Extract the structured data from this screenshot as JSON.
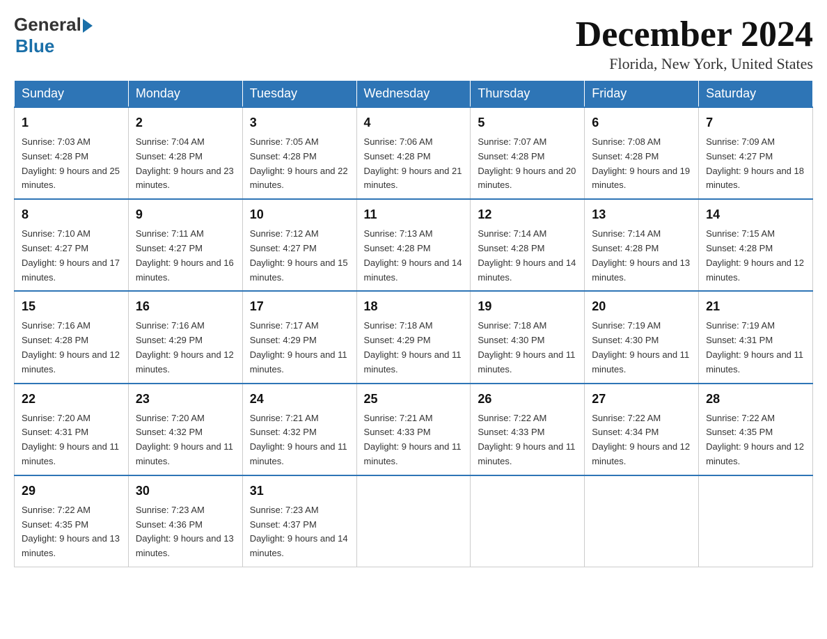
{
  "header": {
    "logo_general": "General",
    "logo_blue": "Blue",
    "logo_underline": "",
    "month_title": "December 2024",
    "location": "Florida, New York, United States"
  },
  "weekdays": [
    "Sunday",
    "Monday",
    "Tuesday",
    "Wednesday",
    "Thursday",
    "Friday",
    "Saturday"
  ],
  "weeks": [
    [
      {
        "day": "1",
        "sunrise": "7:03 AM",
        "sunset": "4:28 PM",
        "daylight": "9 hours and 25 minutes."
      },
      {
        "day": "2",
        "sunrise": "7:04 AM",
        "sunset": "4:28 PM",
        "daylight": "9 hours and 23 minutes."
      },
      {
        "day": "3",
        "sunrise": "7:05 AM",
        "sunset": "4:28 PM",
        "daylight": "9 hours and 22 minutes."
      },
      {
        "day": "4",
        "sunrise": "7:06 AM",
        "sunset": "4:28 PM",
        "daylight": "9 hours and 21 minutes."
      },
      {
        "day": "5",
        "sunrise": "7:07 AM",
        "sunset": "4:28 PM",
        "daylight": "9 hours and 20 minutes."
      },
      {
        "day": "6",
        "sunrise": "7:08 AM",
        "sunset": "4:28 PM",
        "daylight": "9 hours and 19 minutes."
      },
      {
        "day": "7",
        "sunrise": "7:09 AM",
        "sunset": "4:27 PM",
        "daylight": "9 hours and 18 minutes."
      }
    ],
    [
      {
        "day": "8",
        "sunrise": "7:10 AM",
        "sunset": "4:27 PM",
        "daylight": "9 hours and 17 minutes."
      },
      {
        "day": "9",
        "sunrise": "7:11 AM",
        "sunset": "4:27 PM",
        "daylight": "9 hours and 16 minutes."
      },
      {
        "day": "10",
        "sunrise": "7:12 AM",
        "sunset": "4:27 PM",
        "daylight": "9 hours and 15 minutes."
      },
      {
        "day": "11",
        "sunrise": "7:13 AM",
        "sunset": "4:28 PM",
        "daylight": "9 hours and 14 minutes."
      },
      {
        "day": "12",
        "sunrise": "7:14 AM",
        "sunset": "4:28 PM",
        "daylight": "9 hours and 14 minutes."
      },
      {
        "day": "13",
        "sunrise": "7:14 AM",
        "sunset": "4:28 PM",
        "daylight": "9 hours and 13 minutes."
      },
      {
        "day": "14",
        "sunrise": "7:15 AM",
        "sunset": "4:28 PM",
        "daylight": "9 hours and 12 minutes."
      }
    ],
    [
      {
        "day": "15",
        "sunrise": "7:16 AM",
        "sunset": "4:28 PM",
        "daylight": "9 hours and 12 minutes."
      },
      {
        "day": "16",
        "sunrise": "7:16 AM",
        "sunset": "4:29 PM",
        "daylight": "9 hours and 12 minutes."
      },
      {
        "day": "17",
        "sunrise": "7:17 AM",
        "sunset": "4:29 PM",
        "daylight": "9 hours and 11 minutes."
      },
      {
        "day": "18",
        "sunrise": "7:18 AM",
        "sunset": "4:29 PM",
        "daylight": "9 hours and 11 minutes."
      },
      {
        "day": "19",
        "sunrise": "7:18 AM",
        "sunset": "4:30 PM",
        "daylight": "9 hours and 11 minutes."
      },
      {
        "day": "20",
        "sunrise": "7:19 AM",
        "sunset": "4:30 PM",
        "daylight": "9 hours and 11 minutes."
      },
      {
        "day": "21",
        "sunrise": "7:19 AM",
        "sunset": "4:31 PM",
        "daylight": "9 hours and 11 minutes."
      }
    ],
    [
      {
        "day": "22",
        "sunrise": "7:20 AM",
        "sunset": "4:31 PM",
        "daylight": "9 hours and 11 minutes."
      },
      {
        "day": "23",
        "sunrise": "7:20 AM",
        "sunset": "4:32 PM",
        "daylight": "9 hours and 11 minutes."
      },
      {
        "day": "24",
        "sunrise": "7:21 AM",
        "sunset": "4:32 PM",
        "daylight": "9 hours and 11 minutes."
      },
      {
        "day": "25",
        "sunrise": "7:21 AM",
        "sunset": "4:33 PM",
        "daylight": "9 hours and 11 minutes."
      },
      {
        "day": "26",
        "sunrise": "7:22 AM",
        "sunset": "4:33 PM",
        "daylight": "9 hours and 11 minutes."
      },
      {
        "day": "27",
        "sunrise": "7:22 AM",
        "sunset": "4:34 PM",
        "daylight": "9 hours and 12 minutes."
      },
      {
        "day": "28",
        "sunrise": "7:22 AM",
        "sunset": "4:35 PM",
        "daylight": "9 hours and 12 minutes."
      }
    ],
    [
      {
        "day": "29",
        "sunrise": "7:22 AM",
        "sunset": "4:35 PM",
        "daylight": "9 hours and 13 minutes."
      },
      {
        "day": "30",
        "sunrise": "7:23 AM",
        "sunset": "4:36 PM",
        "daylight": "9 hours and 13 minutes."
      },
      {
        "day": "31",
        "sunrise": "7:23 AM",
        "sunset": "4:37 PM",
        "daylight": "9 hours and 14 minutes."
      },
      null,
      null,
      null,
      null
    ]
  ]
}
